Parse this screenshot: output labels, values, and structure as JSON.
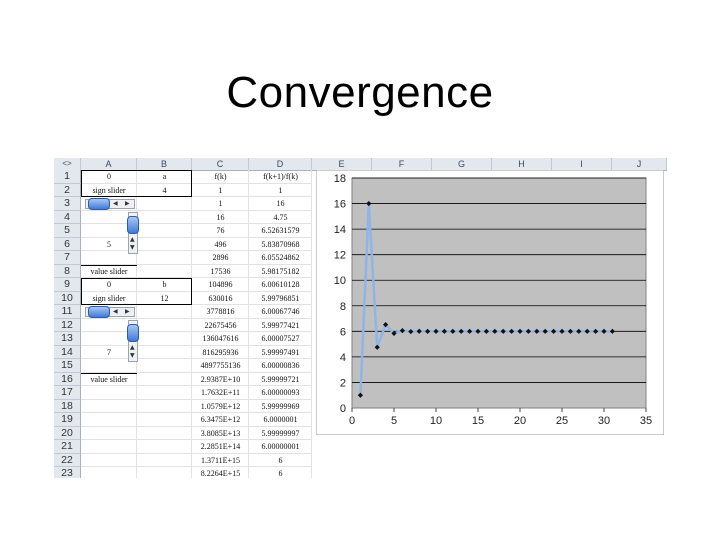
{
  "slide": {
    "title": "Convergence"
  },
  "sheet": {
    "corner": "<>",
    "columns": [
      "A",
      "B",
      "C",
      "D",
      "E",
      "F",
      "G",
      "H",
      "I",
      "J"
    ],
    "rows": [
      "1",
      "2",
      "3",
      "4",
      "5",
      "6",
      "7",
      "8",
      "9",
      "10",
      "11",
      "12",
      "13",
      "14",
      "15",
      "16",
      "17",
      "18",
      "19",
      "20",
      "21",
      "22",
      "23"
    ],
    "cells": [
      {
        "r": 1,
        "c": "A",
        "v": "0"
      },
      {
        "r": 1,
        "c": "B",
        "v": "a"
      },
      {
        "r": 1,
        "c": "C",
        "v": "f(k)"
      },
      {
        "r": 1,
        "c": "D",
        "v": "f(k+1)/f(k)"
      },
      {
        "r": 2,
        "c": "A",
        "v": "sign slider"
      },
      {
        "r": 2,
        "c": "B",
        "v": "4"
      },
      {
        "r": 2,
        "c": "C",
        "v": "1"
      },
      {
        "r": 2,
        "c": "D",
        "v": "1"
      },
      {
        "r": 3,
        "c": "C",
        "v": "1"
      },
      {
        "r": 3,
        "c": "D",
        "v": "16"
      },
      {
        "r": 4,
        "c": "C",
        "v": "16"
      },
      {
        "r": 4,
        "c": "D",
        "v": "4.75"
      },
      {
        "r": 5,
        "c": "C",
        "v": "76"
      },
      {
        "r": 5,
        "c": "D",
        "v": "6.52631579"
      },
      {
        "r": 6,
        "c": "A",
        "v": "5"
      },
      {
        "r": 6,
        "c": "C",
        "v": "496"
      },
      {
        "r": 6,
        "c": "D",
        "v": "5.83870968"
      },
      {
        "r": 7,
        "c": "C",
        "v": "2896"
      },
      {
        "r": 7,
        "c": "D",
        "v": "6.05524862"
      },
      {
        "r": 8,
        "c": "A",
        "v": "value slider"
      },
      {
        "r": 8,
        "c": "C",
        "v": "17536"
      },
      {
        "r": 8,
        "c": "D",
        "v": "5.98175182"
      },
      {
        "r": 9,
        "c": "A",
        "v": "0"
      },
      {
        "r": 9,
        "c": "B",
        "v": "b"
      },
      {
        "r": 9,
        "c": "C",
        "v": "104896"
      },
      {
        "r": 9,
        "c": "D",
        "v": "6.00610128"
      },
      {
        "r": 10,
        "c": "A",
        "v": "sign slider"
      },
      {
        "r": 10,
        "c": "B",
        "v": "12"
      },
      {
        "r": 10,
        "c": "C",
        "v": "630016"
      },
      {
        "r": 10,
        "c": "D",
        "v": "5.99796851"
      },
      {
        "r": 11,
        "c": "C",
        "v": "3778816"
      },
      {
        "r": 11,
        "c": "D",
        "v": "6.00067746"
      },
      {
        "r": 12,
        "c": "C",
        "v": "22675456"
      },
      {
        "r": 12,
        "c": "D",
        "v": "5.99977421"
      },
      {
        "r": 13,
        "c": "C",
        "v": "136047616"
      },
      {
        "r": 13,
        "c": "D",
        "v": "6.00007527"
      },
      {
        "r": 14,
        "c": "A",
        "v": "7"
      },
      {
        "r": 14,
        "c": "C",
        "v": "816295936"
      },
      {
        "r": 14,
        "c": "D",
        "v": "5.99997491"
      },
      {
        "r": 15,
        "c": "C",
        "v": "4897755136"
      },
      {
        "r": 15,
        "c": "D",
        "v": "6.00000836"
      },
      {
        "r": 16,
        "c": "A",
        "v": "value slider"
      },
      {
        "r": 16,
        "c": "C",
        "v": "2.9387E+10"
      },
      {
        "r": 16,
        "c": "D",
        "v": "5.99999721"
      },
      {
        "r": 17,
        "c": "C",
        "v": "1.7632E+11"
      },
      {
        "r": 17,
        "c": "D",
        "v": "6.00000093"
      },
      {
        "r": 18,
        "c": "C",
        "v": "1.0579E+12"
      },
      {
        "r": 18,
        "c": "D",
        "v": "5.99999969"
      },
      {
        "r": 19,
        "c": "C",
        "v": "6.3475E+12"
      },
      {
        "r": 19,
        "c": "D",
        "v": "6.0000001"
      },
      {
        "r": 20,
        "c": "C",
        "v": "3.8085E+13"
      },
      {
        "r": 20,
        "c": "D",
        "v": "5.99999997"
      },
      {
        "r": 21,
        "c": "C",
        "v": "2.2851E+14"
      },
      {
        "r": 21,
        "c": "D",
        "v": "6.00000001"
      },
      {
        "r": 22,
        "c": "C",
        "v": "1.3711E+15"
      },
      {
        "r": 22,
        "c": "D",
        "v": "6"
      },
      {
        "r": 23,
        "c": "C",
        "v": "8.2264E+15"
      },
      {
        "r": 23,
        "c": "D",
        "v": "6"
      }
    ],
    "controls": [
      {
        "name": "sign-slider-a-scrollbar",
        "type": "horizontal",
        "value": 0
      },
      {
        "name": "value-slider-a-scrollbar",
        "type": "vertical",
        "value": 5
      },
      {
        "name": "sign-slider-b-scrollbar",
        "type": "horizontal",
        "value": 0
      },
      {
        "name": "value-slider-b-scrollbar",
        "type": "vertical",
        "value": 7
      }
    ]
  },
  "chart_data": {
    "type": "scatter",
    "title": "",
    "xlabel": "",
    "ylabel": "",
    "xlim": [
      0,
      35
    ],
    "ylim": [
      0,
      18
    ],
    "xticks": [
      0,
      5,
      10,
      15,
      20,
      25,
      30,
      35
    ],
    "yticks": [
      0,
      2,
      4,
      6,
      8,
      10,
      12,
      14,
      16,
      18
    ],
    "grid": true,
    "legend": "none",
    "plot_background": "#c0c0c0",
    "line_color": "#8fb4e8",
    "marker_color": "#111111",
    "series": [
      {
        "x": [
          1,
          2,
          3,
          4,
          5,
          6,
          7,
          8,
          9,
          10,
          11,
          12,
          13,
          14,
          15,
          16,
          17,
          18,
          19,
          20,
          21,
          22,
          23,
          24,
          25,
          26,
          27,
          28,
          29,
          30,
          31
        ],
        "y": [
          1,
          16,
          4.75,
          6.52631579,
          5.83870968,
          6.05524862,
          5.98175182,
          6.00610128,
          5.99796851,
          6.00067746,
          5.99977421,
          6.00007527,
          5.99997491,
          6.00000836,
          5.99999721,
          6.00000093,
          5.99999969,
          6.0000001,
          5.99999997,
          6.00000001,
          6,
          6,
          6,
          6,
          6,
          6,
          6,
          6,
          6,
          6,
          6
        ]
      }
    ]
  }
}
